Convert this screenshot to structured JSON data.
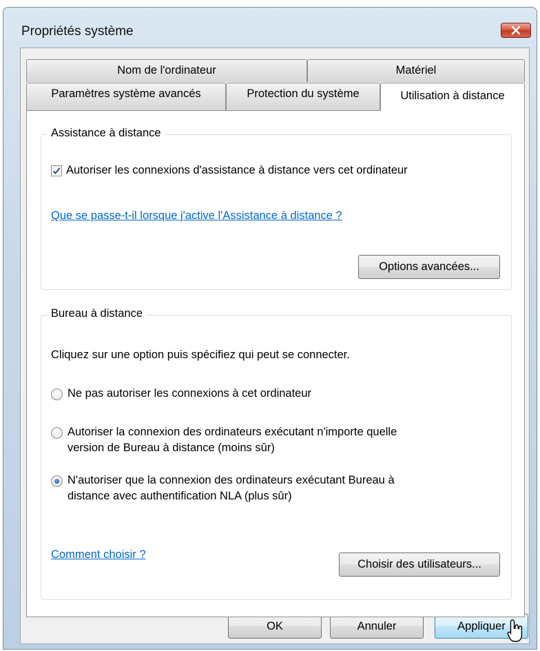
{
  "window": {
    "title": "Propriétés système"
  },
  "tabs": {
    "row_top": [
      {
        "label": "Nom de l'ordinateur"
      },
      {
        "label": "Matériel"
      }
    ],
    "row_bottom": [
      {
        "label": "Paramètres système avancés"
      },
      {
        "label": "Protection du système"
      },
      {
        "label": "Utilisation à distance",
        "active": true
      }
    ]
  },
  "assistance": {
    "title": "Assistance à distance",
    "checkbox_label": "Autoriser les connexions d'assistance à distance vers cet ordinateur",
    "checkbox_checked": true,
    "help_link": "Que se passe-t-il lorsque j'active l'Assistance à distance ?",
    "advanced_button": "Options avancées..."
  },
  "bureau": {
    "title": "Bureau à distance",
    "instruction": "Cliquez sur une option puis spécifiez qui peut se connecter.",
    "option1": "Ne pas autoriser les connexions à cet ordinateur",
    "option2_line1": "Autoriser la connexion des ordinateurs exécutant n'importe quelle",
    "option2_line2": "version de Bureau à distance (moins sûr)",
    "option3_line1": "N'autoriser que la connexion des ordinateurs exécutant Bureau à",
    "option3_line2": "distance avec authentification NLA (plus sûr)",
    "selected_option": 3,
    "help_link": "Comment choisir ?",
    "users_button": "Choisir des utilisateurs..."
  },
  "footer": {
    "ok": "OK",
    "cancel": "Annuler",
    "apply": "Appliquer"
  },
  "colors": {
    "link": "#0066cc",
    "close_button": "#c23a22"
  }
}
